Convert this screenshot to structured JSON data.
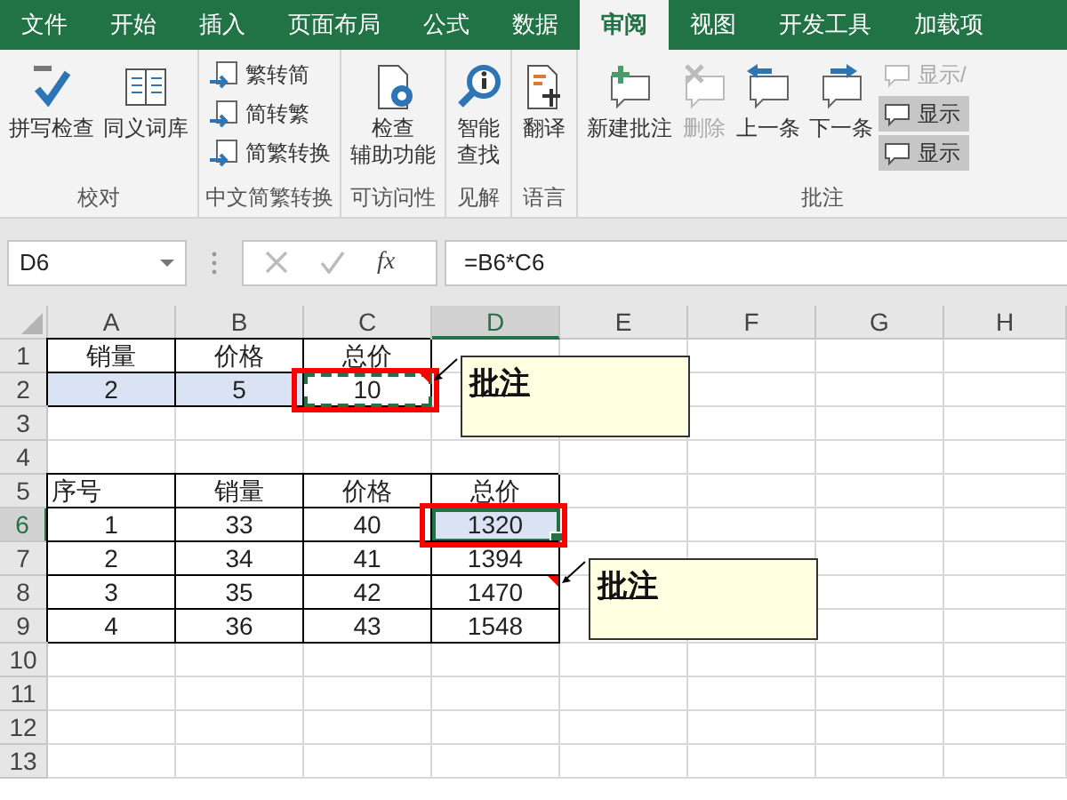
{
  "tabs": [
    {
      "label": "文件",
      "selected": false
    },
    {
      "label": "开始",
      "selected": false
    },
    {
      "label": "插入",
      "selected": false
    },
    {
      "label": "页面布局",
      "selected": false
    },
    {
      "label": "公式",
      "selected": false
    },
    {
      "label": "数据",
      "selected": false
    },
    {
      "label": "审阅",
      "selected": true
    },
    {
      "label": "视图",
      "selected": false
    },
    {
      "label": "开发工具",
      "selected": false
    },
    {
      "label": "加载项",
      "selected": false
    }
  ],
  "ribbon": {
    "groups": [
      {
        "label": "校对",
        "buttons": [
          {
            "lines": [
              "拼写检查"
            ],
            "disabled": false
          },
          {
            "lines": [
              "同义词库"
            ],
            "disabled": false
          }
        ]
      },
      {
        "label": "中文简繁转换",
        "small_buttons": [
          {
            "label": "繁转简",
            "disabled": false,
            "on": false
          },
          {
            "label": "简转繁",
            "disabled": false,
            "on": false
          },
          {
            "label": "简繁转换",
            "disabled": false,
            "on": false
          }
        ]
      },
      {
        "label": "可访问性",
        "buttons": [
          {
            "lines": [
              "检查",
              "辅助功能"
            ],
            "disabled": false
          }
        ]
      },
      {
        "label": "见解",
        "buttons": [
          {
            "lines": [
              "智能",
              "查找"
            ],
            "disabled": false
          }
        ]
      },
      {
        "label": "语言",
        "buttons": [
          {
            "lines": [
              "翻译"
            ],
            "disabled": false
          }
        ]
      },
      {
        "label": "批注",
        "buttons": [
          {
            "lines": [
              "新建批注"
            ],
            "disabled": false
          },
          {
            "lines": [
              "删除"
            ],
            "disabled": true
          },
          {
            "lines": [
              "上一条"
            ],
            "disabled": false
          },
          {
            "lines": [
              "下一条"
            ],
            "disabled": false
          }
        ],
        "small_buttons": [
          {
            "label": "显示/",
            "disabled": true,
            "on": false
          },
          {
            "label": "显示",
            "disabled": false,
            "on": true
          },
          {
            "label": "显示",
            "disabled": false,
            "on": true
          }
        ]
      }
    ]
  },
  "formula_bar": {
    "name_box": "D6",
    "function_label": "fx",
    "formula": "=B6*C6"
  },
  "sheet": {
    "columns": [
      "A",
      "B",
      "C",
      "D",
      "E",
      "F",
      "G",
      "H"
    ],
    "rows": [
      {
        "header": "1",
        "bordered": true,
        "cells": [
          {
            "text": "销量",
            "highlighted": false,
            "copied": false,
            "active": false,
            "outlined": false,
            "left_aligned": false
          },
          {
            "text": "价格",
            "highlighted": false,
            "copied": false,
            "active": false,
            "outlined": false,
            "left_aligned": false
          },
          {
            "text": "总价",
            "highlighted": false,
            "copied": false,
            "active": false,
            "outlined": false,
            "left_aligned": false
          }
        ]
      },
      {
        "header": "2",
        "bordered": true,
        "cells": [
          {
            "text": "2",
            "highlighted": true,
            "copied": false,
            "active": false,
            "outlined": false,
            "left_aligned": false
          },
          {
            "text": "5",
            "highlighted": true,
            "copied": false,
            "active": false,
            "outlined": false,
            "left_aligned": false
          },
          {
            "text": "10",
            "highlighted": false,
            "copied": true,
            "active": false,
            "outlined": true,
            "left_aligned": false,
            "comment": "批注"
          }
        ]
      },
      {
        "header": "3",
        "cells": []
      },
      {
        "header": "4",
        "cells": []
      },
      {
        "header": "5",
        "bordered": true,
        "cells": [
          {
            "text": "序号",
            "highlighted": false,
            "copied": false,
            "active": false,
            "outlined": false,
            "left_aligned": true
          },
          {
            "text": "销量",
            "highlighted": false,
            "copied": false,
            "active": false,
            "outlined": false,
            "left_aligned": false
          },
          {
            "text": "价格",
            "highlighted": false,
            "copied": false,
            "active": false,
            "outlined": false,
            "left_aligned": false
          },
          {
            "text": "总价",
            "highlighted": false,
            "copied": false,
            "active": false,
            "outlined": false,
            "left_aligned": false
          }
        ]
      },
      {
        "header": "6",
        "bordered": true,
        "cells": [
          {
            "text": "1",
            "highlighted": false,
            "copied": false,
            "active": false,
            "outlined": false,
            "left_aligned": false
          },
          {
            "text": "33",
            "highlighted": false,
            "copied": false,
            "active": false,
            "outlined": false,
            "left_aligned": false
          },
          {
            "text": "40",
            "highlighted": false,
            "copied": false,
            "active": false,
            "outlined": false,
            "left_aligned": false
          },
          {
            "text": "1320",
            "highlighted": true,
            "copied": false,
            "active": true,
            "outlined": true,
            "left_aligned": false
          }
        ]
      },
      {
        "header": "7",
        "bordered": true,
        "cells": [
          {
            "text": "2",
            "highlighted": false,
            "copied": false,
            "active": false,
            "outlined": false,
            "left_aligned": false
          },
          {
            "text": "34",
            "highlighted": false,
            "copied": false,
            "active": false,
            "outlined": false,
            "left_aligned": false
          },
          {
            "text": "41",
            "highlighted": false,
            "copied": false,
            "active": false,
            "outlined": false,
            "left_aligned": false
          },
          {
            "text": "1394",
            "highlighted": false,
            "copied": false,
            "active": false,
            "outlined": false,
            "left_aligned": false
          }
        ]
      },
      {
        "header": "8",
        "bordered": true,
        "cells": [
          {
            "text": "3",
            "highlighted": false,
            "copied": false,
            "active": false,
            "outlined": false,
            "left_aligned": false
          },
          {
            "text": "35",
            "highlighted": false,
            "copied": false,
            "active": false,
            "outlined": false,
            "left_aligned": false
          },
          {
            "text": "42",
            "highlighted": false,
            "copied": false,
            "active": false,
            "outlined": false,
            "left_aligned": false
          },
          {
            "text": "1470",
            "highlighted": false,
            "copied": false,
            "active": false,
            "outlined": false,
            "left_aligned": false,
            "comment": "批注"
          }
        ]
      },
      {
        "header": "9",
        "bordered": true,
        "cells": [
          {
            "text": "4",
            "highlighted": false,
            "copied": false,
            "active": false,
            "outlined": false,
            "left_aligned": false
          },
          {
            "text": "36",
            "highlighted": false,
            "copied": false,
            "active": false,
            "outlined": false,
            "left_aligned": false
          },
          {
            "text": "43",
            "highlighted": false,
            "copied": false,
            "active": false,
            "outlined": false,
            "left_aligned": false
          },
          {
            "text": "1548",
            "highlighted": false,
            "copied": false,
            "active": false,
            "outlined": false,
            "left_aligned": false
          }
        ]
      },
      {
        "header": "10",
        "cells": []
      },
      {
        "header": "11",
        "cells": []
      },
      {
        "header": "12",
        "cells": []
      },
      {
        "header": "13",
        "cells": []
      }
    ]
  }
}
